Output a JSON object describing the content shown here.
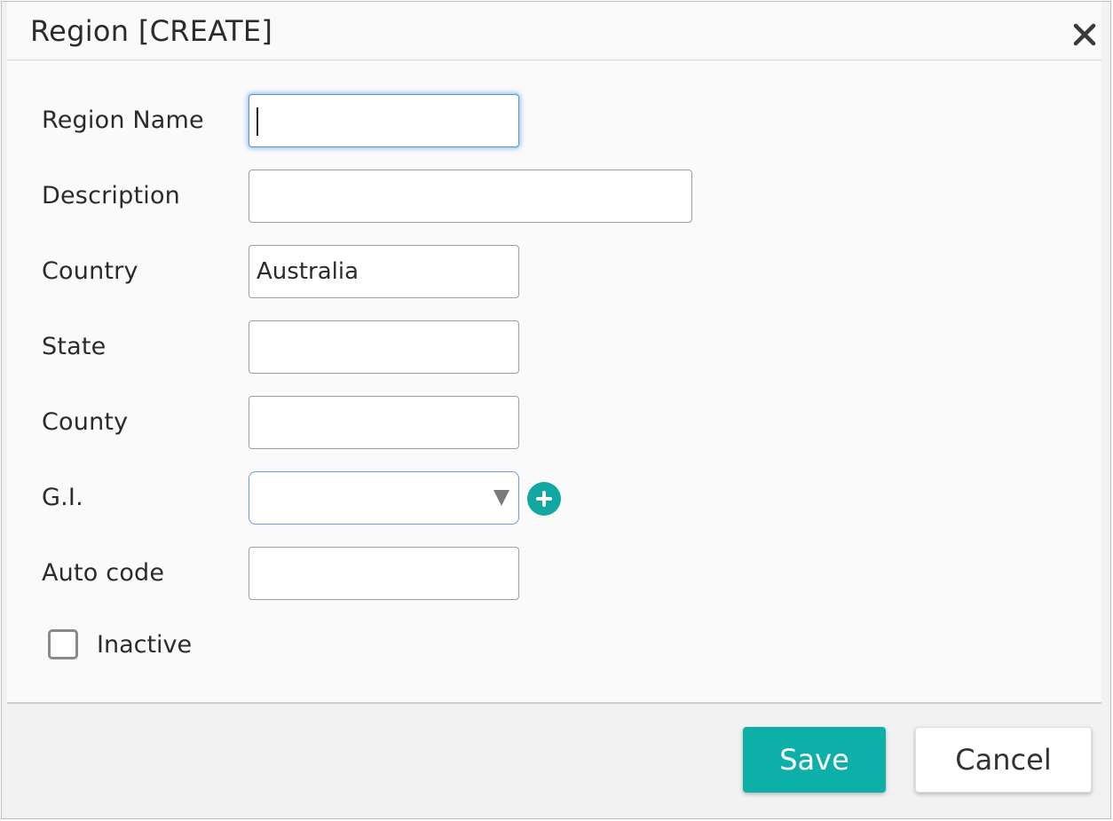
{
  "dialog": {
    "title": "Region [CREATE]",
    "close_icon": "close-icon"
  },
  "form": {
    "region_name": {
      "label": "Region Name",
      "value": ""
    },
    "description": {
      "label": "Description",
      "value": ""
    },
    "country": {
      "label": "Country",
      "value": "Australia"
    },
    "state": {
      "label": "State",
      "value": ""
    },
    "county": {
      "label": "County",
      "value": ""
    },
    "gi": {
      "label": "G.I.",
      "value": "",
      "add_icon": "plus-circle-icon",
      "accent": "#12a7a0"
    },
    "auto_code": {
      "label": "Auto code",
      "value": ""
    },
    "inactive": {
      "label": "Inactive",
      "checked": false
    }
  },
  "actions": {
    "save_label": "Save",
    "cancel_label": "Cancel",
    "save_color": "#0cb0a9"
  }
}
